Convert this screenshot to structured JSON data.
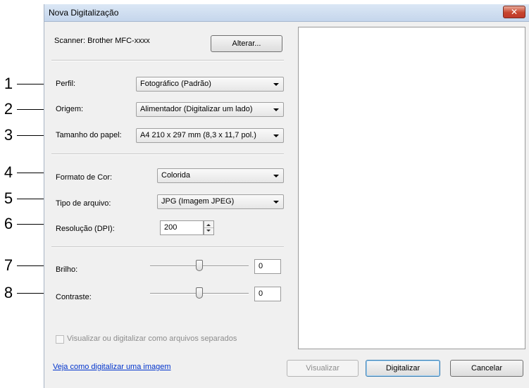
{
  "window": {
    "title": "Nova Digitalização",
    "close_glyph": "✕"
  },
  "scanner": {
    "label": "Scanner: Brother MFC-xxxx",
    "change_button": "Alterar..."
  },
  "fields": {
    "profile": {
      "label": "Perfil:",
      "value": "Fotográfico (Padrão)"
    },
    "source": {
      "label": "Origem:",
      "value": "Alimentador (Digitalizar um lado)"
    },
    "paper_size": {
      "label": "Tamanho do papel:",
      "value": "A4 210 x 297 mm (8,3 x 11,7 pol.)"
    },
    "color_format": {
      "label": "Formato de Cor:",
      "value": "Colorida"
    },
    "file_type": {
      "label": "Tipo de arquivo:",
      "value": "JPG (Imagem JPEG)"
    },
    "resolution": {
      "label": "Resolução (DPI):",
      "value": "200"
    },
    "brightness": {
      "label": "Brilho:",
      "value": "0",
      "level": 0.5
    },
    "contrast": {
      "label": "Contraste:",
      "value": "0",
      "level": 0.5
    }
  },
  "separate_files": {
    "label": "Visualizar ou digitalizar como arquivos separados",
    "checked": false
  },
  "help_link": "Veja como digitalizar uma imagem",
  "buttons": {
    "preview": "Visualizar",
    "scan": "Digitalizar",
    "cancel": "Cancelar"
  },
  "callouts": [
    "1",
    "2",
    "3",
    "4",
    "5",
    "6",
    "7",
    "8"
  ]
}
